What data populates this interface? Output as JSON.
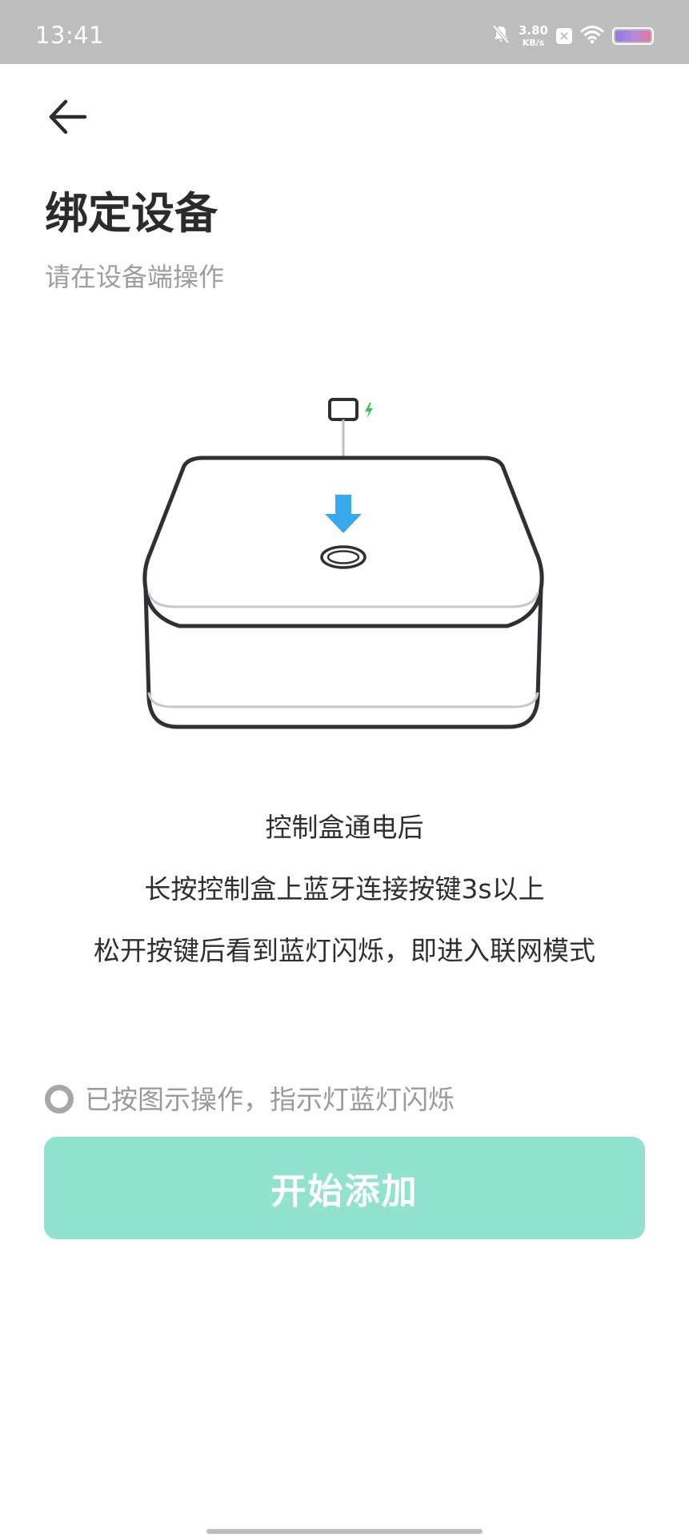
{
  "status_bar": {
    "time": "13:41",
    "net_speed_value": "3.80",
    "net_speed_unit": "KB/s",
    "icons": [
      "bell-muted-icon",
      "close-box-icon",
      "wifi-icon",
      "battery-icon"
    ]
  },
  "header": {
    "back_icon": "arrow-left-icon",
    "title": "绑定设备",
    "subtitle": "请在设备端操作"
  },
  "illustration": {
    "description_icons": [
      "control-box-icon",
      "power-plug-icon",
      "charging-bolt-icon",
      "press-down-arrow-icon",
      "bluetooth-button-icon"
    ],
    "colors": {
      "outline": "#2f2f35",
      "arrow": "#3aa8ee",
      "bolt": "#3ec255"
    }
  },
  "instructions": [
    "控制盒通电后",
    "长按控制盒上蓝牙连接按键3s以上",
    "松开按键后看到蓝灯闪烁，即进入联网模式"
  ],
  "confirm": {
    "label": "已按图示操作，指示灯蓝灯闪烁",
    "checked": false
  },
  "start_button": {
    "label": "开始添加",
    "enabled": false,
    "color": "#92e2d0"
  }
}
